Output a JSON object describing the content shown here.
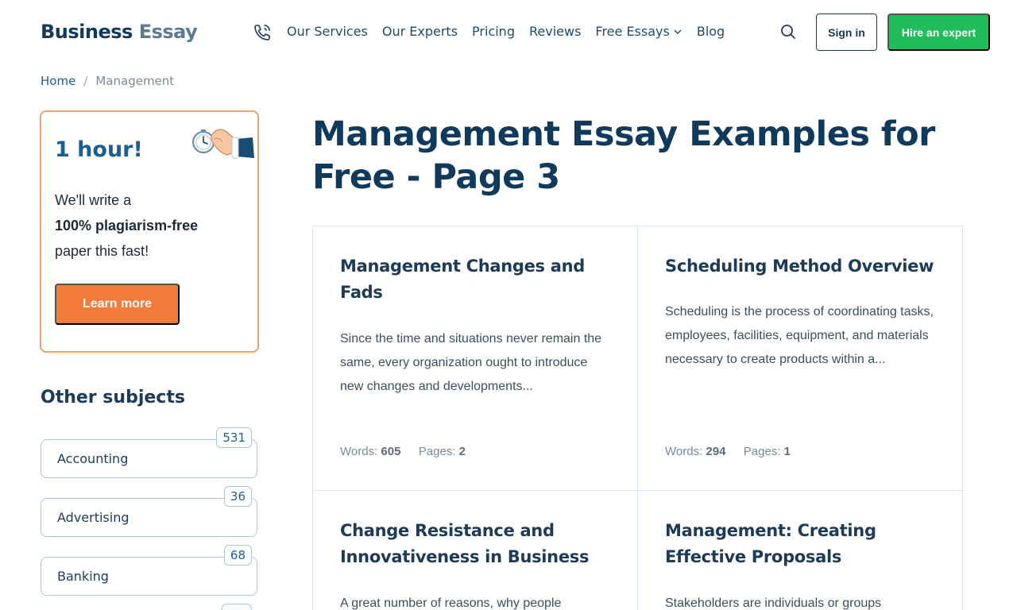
{
  "header": {
    "logo_part1": "Business",
    "logo_part2": "Essay",
    "nav": [
      {
        "label": "Our Services"
      },
      {
        "label": "Our Experts"
      },
      {
        "label": "Pricing"
      },
      {
        "label": "Reviews"
      },
      {
        "label": "Free Essays"
      },
      {
        "label": "Blog"
      }
    ],
    "signin_label": "Sign in",
    "hire_label": "Hire an expert"
  },
  "breadcrumb": {
    "home": "Home",
    "separator": "/",
    "current": "Management"
  },
  "promo": {
    "title": "1 hour!",
    "line1": "We'll write a",
    "line2": "100% plagiarism-free",
    "line3": "paper this fast!",
    "button": "Learn more"
  },
  "subjects": {
    "title": "Other subjects",
    "items": [
      {
        "label": "Accounting",
        "count": "531"
      },
      {
        "label": "Advertising",
        "count": "36"
      },
      {
        "label": "Banking",
        "count": "68"
      }
    ]
  },
  "main": {
    "title": "Management Essay Examples for Free - Page 3",
    "words_label": "Words:",
    "pages_label": "Pages:",
    "cards": [
      {
        "title": "Management Changes and Fads",
        "excerpt": "Since the time and situations never remain the same, every organization ought to introduce new changes and developments...",
        "words": "605",
        "pages": "2"
      },
      {
        "title": "Scheduling Method Overview",
        "excerpt": "Scheduling is the process of coordinating tasks, employees, facilities, equipment, and materials necessary to create products within a...",
        "words": "294",
        "pages": "1"
      },
      {
        "title": "Change Resistance and Innovativeness in Business",
        "excerpt": "A great number of reasons, why people",
        "words": "",
        "pages": ""
      },
      {
        "title": "Management: Creating Effective Proposals",
        "excerpt": "Stakeholders are individuals or groups",
        "words": "",
        "pages": ""
      }
    ]
  },
  "colors": {
    "brand_dark": "#0f3a5c",
    "link_blue": "#1b5e96",
    "hire_green": "#1fbd5c",
    "cta_orange": "#f47b3a",
    "promo_border": "#f1a36a"
  },
  "icons": {
    "phone": "phone-icon",
    "search": "search-icon",
    "chevron": "chevron-down-icon",
    "promo": "hand-with-stopwatch-icon"
  }
}
